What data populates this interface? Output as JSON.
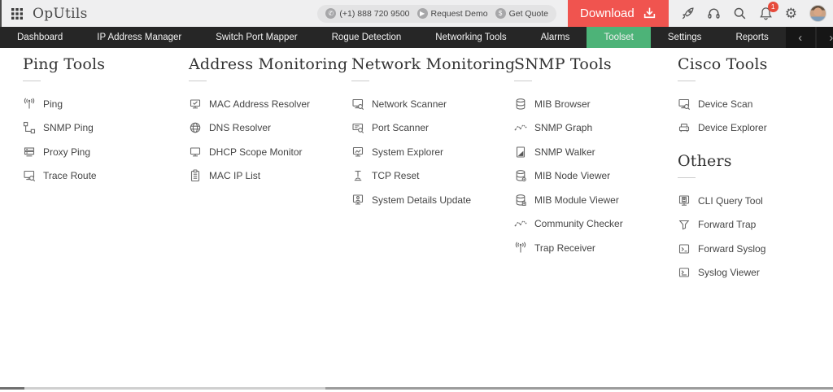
{
  "app": {
    "title": "OpUtils"
  },
  "topbar": {
    "phone": "(+1) 888 720 9500",
    "request_demo_label": "Request Demo",
    "get_quote_label": "Get Quote",
    "download_label": "Download",
    "notification_count": "1"
  },
  "nav": {
    "tabs": [
      {
        "label": "Dashboard",
        "active": false
      },
      {
        "label": "IP Address Manager",
        "active": false
      },
      {
        "label": "Switch Port Mapper",
        "active": false
      },
      {
        "label": "Rogue Detection",
        "active": false
      },
      {
        "label": "Networking Tools",
        "active": false
      },
      {
        "label": "Alarms",
        "active": false
      },
      {
        "label": "Toolset",
        "active": true
      },
      {
        "label": "Settings",
        "active": false
      },
      {
        "label": "Reports",
        "active": false
      }
    ]
  },
  "toolset": {
    "columns": [
      {
        "sections": [
          {
            "title": "Ping Tools",
            "items": [
              {
                "label": "Ping",
                "icon": "antenna"
              },
              {
                "label": "SNMP Ping",
                "icon": "network-nodes"
              },
              {
                "label": "Proxy Ping",
                "icon": "server-stack"
              },
              {
                "label": "Trace Route",
                "icon": "monitor-search"
              }
            ]
          }
        ]
      },
      {
        "sections": [
          {
            "title": "Address Monitoring",
            "items": [
              {
                "label": "MAC Address Resolver",
                "icon": "monitor-check"
              },
              {
                "label": "DNS Resolver",
                "icon": "globe"
              },
              {
                "label": "DHCP Scope Monitor",
                "icon": "monitor"
              },
              {
                "label": "MAC IP List",
                "icon": "clipboard"
              }
            ]
          }
        ]
      },
      {
        "sections": [
          {
            "title": "Network Monitoring",
            "items": [
              {
                "label": "Network Scanner",
                "icon": "monitor-search"
              },
              {
                "label": "Port Scanner",
                "icon": "screen-search"
              },
              {
                "label": "System Explorer",
                "icon": "monitor-chart"
              },
              {
                "label": "TCP Reset",
                "icon": "plunger"
              },
              {
                "label": "System Details Update",
                "icon": "monitor-person"
              }
            ]
          }
        ]
      },
      {
        "sections": [
          {
            "title": "SNMP Tools",
            "items": [
              {
                "label": "MIB Browser",
                "icon": "database"
              },
              {
                "label": "SNMP Graph",
                "icon": "line-graph"
              },
              {
                "label": "SNMP Walker",
                "icon": "doc-chart"
              },
              {
                "label": "MIB Node Viewer",
                "icon": "database-node"
              },
              {
                "label": "MIB Module Viewer",
                "icon": "database-module"
              },
              {
                "label": "Community Checker",
                "icon": "line-graph"
              },
              {
                "label": "Trap Receiver",
                "icon": "antenna"
              }
            ]
          }
        ]
      },
      {
        "sections": [
          {
            "title": "Cisco Tools",
            "items": [
              {
                "label": "Device Scan",
                "icon": "monitor-search"
              },
              {
                "label": "Device Explorer",
                "icon": "device"
              }
            ]
          },
          {
            "title": "Others",
            "items": [
              {
                "label": "CLI Query Tool",
                "icon": "cli-terminal"
              },
              {
                "label": "Forward Trap",
                "icon": "funnel"
              },
              {
                "label": "Forward Syslog",
                "icon": "terminal"
              },
              {
                "label": "Syslog Viewer",
                "icon": "terminal-view"
              }
            ]
          }
        ]
      }
    ]
  },
  "colors": {
    "accent_green": "#4db378",
    "download_red": "#f0544f",
    "badge_red": "#e64a3b",
    "nav_dark": "#262626"
  }
}
